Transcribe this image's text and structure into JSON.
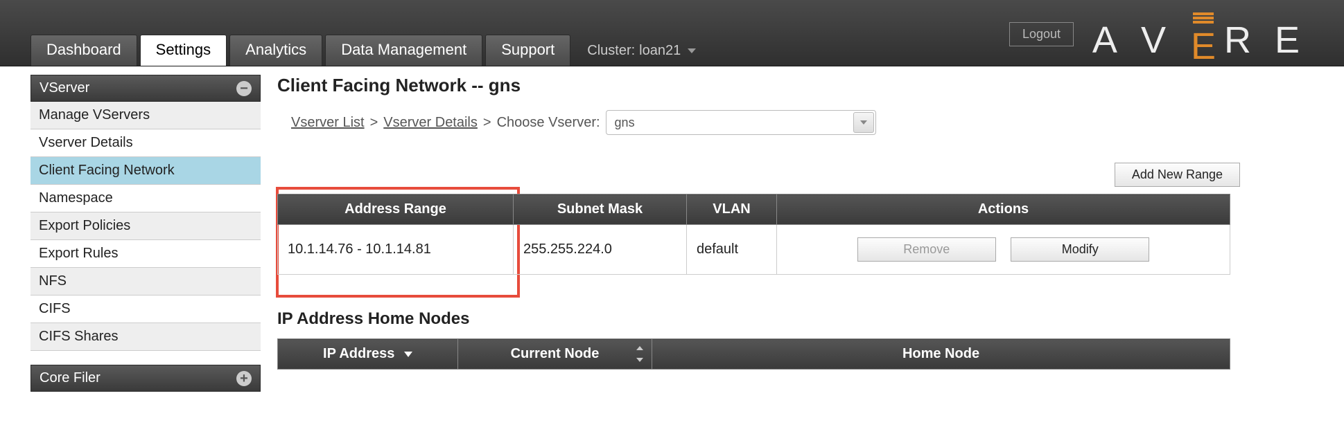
{
  "header": {
    "logout": "Logout",
    "logo_letters": [
      "A",
      "V",
      "E",
      "R",
      "E"
    ]
  },
  "tabs": {
    "dashboard": "Dashboard",
    "settings": "Settings",
    "analytics": "Analytics",
    "data_mgmt": "Data Management",
    "support": "Support"
  },
  "cluster": {
    "label_prefix": "Cluster: ",
    "name": "loan21"
  },
  "sidebar": {
    "section1": {
      "title": "VServer",
      "items": [
        "Manage VServers",
        "Vserver Details",
        "Client Facing Network",
        "Namespace",
        "Export Policies",
        "Export Rules",
        "NFS",
        "CIFS",
        "CIFS Shares"
      ],
      "selected_index": 2
    },
    "section2": {
      "title": "Core Filer"
    }
  },
  "main": {
    "page_title": "Client Facing Network -- gns",
    "breadcrumb": {
      "vserver_list": "Vserver List",
      "vserver_details": "Vserver Details",
      "choose_label": "Choose Vserver:",
      "selected_vserver": "gns",
      "sep": ">"
    },
    "buttons": {
      "add_new_range": "Add New Range",
      "remove": "Remove",
      "modify": "Modify"
    },
    "range_table": {
      "headers": {
        "address_range": "Address Range",
        "subnet_mask": "Subnet Mask",
        "vlan": "VLAN",
        "actions": "Actions"
      },
      "rows": [
        {
          "address_range": "10.1.14.76 - 10.1.14.81",
          "subnet_mask": "255.255.224.0",
          "vlan": "default"
        }
      ]
    },
    "home_nodes": {
      "title": "IP Address Home Nodes",
      "headers": {
        "ip_address": "IP Address",
        "current_node": "Current Node",
        "home_node": "Home Node"
      }
    }
  }
}
